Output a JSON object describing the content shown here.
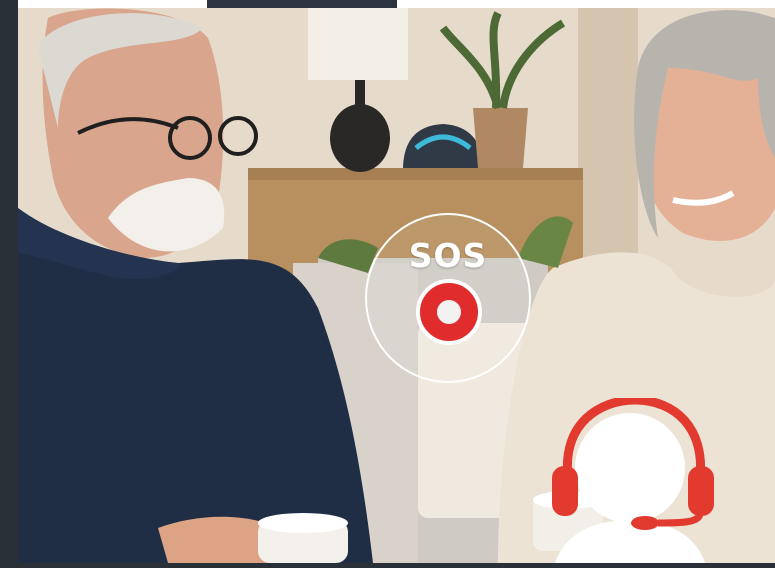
{
  "sos_widget": {
    "label": "SOS",
    "button_color": "#e02c2c",
    "ring_color": "#ffffff"
  },
  "support_agent": {
    "icon": "headset-agent-icon",
    "headset_color": "#e23a2f",
    "figure_color": "#ffffff"
  },
  "colors": {
    "rail": "#2a3038",
    "top_strip": "#ffffff",
    "tab_indicator": "#2c3440"
  }
}
